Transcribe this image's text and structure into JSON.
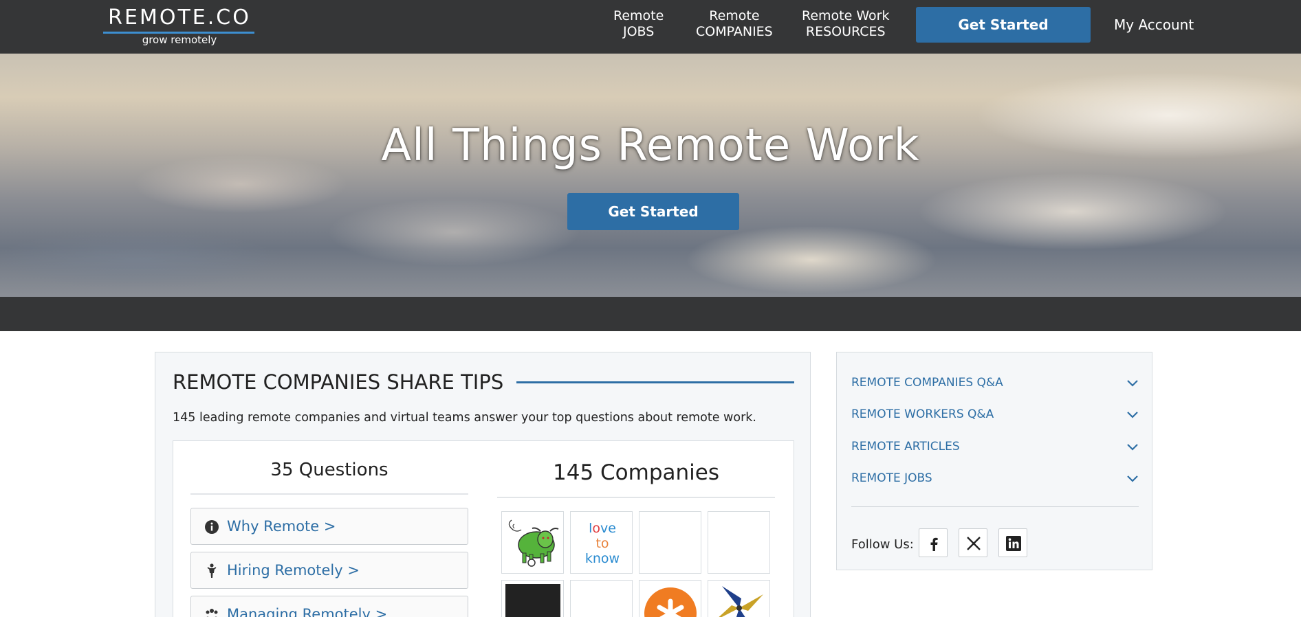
{
  "header": {
    "logo_text": "REMOTE.CO",
    "logo_tagline": "grow remotely",
    "nav": [
      {
        "line1": "Remote",
        "line2": "JOBS"
      },
      {
        "line1": "Remote",
        "line2": "COMPANIES"
      },
      {
        "line1": "Remote Work",
        "line2": "RESOURCES"
      }
    ],
    "cta_label": "Get Started",
    "account_label": "My Account"
  },
  "hero": {
    "title": "All Things Remote Work",
    "cta_label": "Get Started"
  },
  "main": {
    "title": "REMOTE COMPANIES SHARE TIPS",
    "description": "145 leading remote companies and virtual teams answer your top questions about remote work.",
    "questions_heading": "35 Questions",
    "companies_heading": "145 Companies",
    "questions": [
      {
        "label": "Why Remote >",
        "icon": "info-icon"
      },
      {
        "label": "Hiring Remotely >",
        "icon": "person-icon"
      },
      {
        "label": "Managing Remotely >",
        "icon": "group-icon"
      }
    ],
    "company_logos": [
      {
        "name": "bull-logo",
        "text": ""
      },
      {
        "name": "lovetoknow-logo",
        "text": "love to know"
      },
      {
        "name": "blank-logo-1",
        "text": ""
      },
      {
        "name": "blank-logo-2",
        "text": ""
      },
      {
        "name": "black-logo",
        "text": ""
      },
      {
        "name": "blank-logo-3",
        "text": ""
      },
      {
        "name": "orange-asterisk-logo",
        "text": ""
      },
      {
        "name": "pinwheel-logo",
        "text": ""
      }
    ]
  },
  "sidebar": {
    "items": [
      {
        "label": "REMOTE COMPANIES Q&A"
      },
      {
        "label": "REMOTE WORKERS Q&A"
      },
      {
        "label": "REMOTE ARTICLES"
      },
      {
        "label": "REMOTE JOBS"
      }
    ],
    "follow_label": "Follow Us:",
    "social": [
      "facebook-icon",
      "x-icon",
      "linkedin-icon"
    ]
  },
  "colors": {
    "nav_bg": "#353637",
    "brand_blue": "#2d6ea5",
    "logo_underline": "#3d8fd1",
    "panel_bg": "#f5f7f9"
  }
}
